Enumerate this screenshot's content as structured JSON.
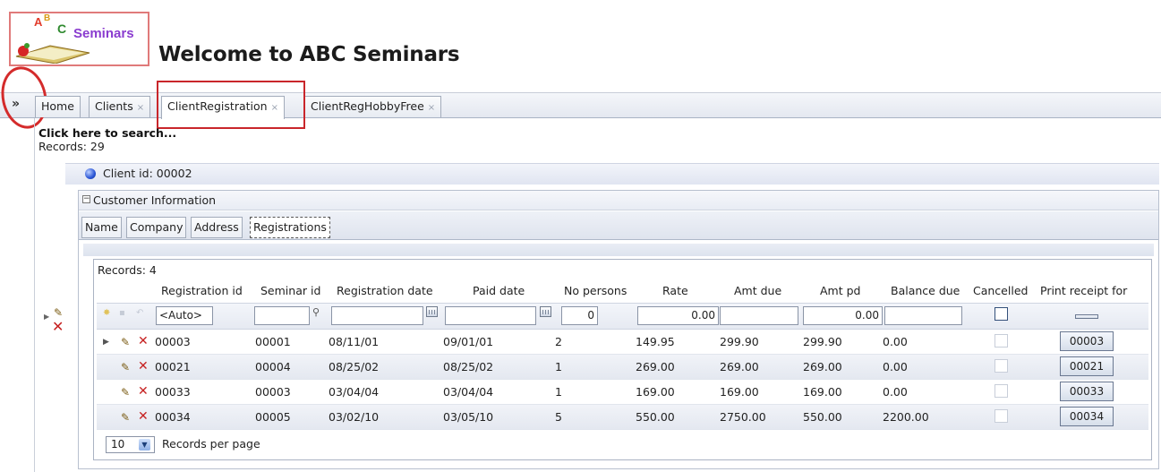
{
  "header": {
    "logo_text": "ABC Seminars",
    "welcome": "Welcome to ABC Seminars"
  },
  "nav": {
    "expand_icon": "»",
    "tabs": [
      {
        "label": "Home",
        "closable": false
      },
      {
        "label": "Clients",
        "closable": true
      },
      {
        "label": "ClientRegistration",
        "closable": true,
        "active": true
      },
      {
        "label": "ClientRegHobbyFree",
        "closable": true
      }
    ],
    "close_glyph": "×"
  },
  "main": {
    "search_link": "Click here to search...",
    "records_label": "Records: 29",
    "client_label": "Client id: 00002",
    "section_title": "Customer Information",
    "section_toggle": "⊟",
    "subtabs": [
      "Name",
      "Company",
      "Address",
      "Registrations"
    ],
    "active_subtab": "Registrations"
  },
  "grid": {
    "records_label": "Records: 4",
    "columns": [
      "Registration id",
      "Seminar id",
      "Registration date",
      "Paid date",
      "No persons",
      "Rate",
      "Amt due",
      "Amt pd",
      "Balance due",
      "Cancelled",
      "Print receipt for"
    ],
    "new_row": {
      "registration_id": "<Auto>",
      "seminar_id": "",
      "registration_date": "",
      "paid_date": "",
      "no_persons": "0",
      "rate": "0.00",
      "amt_due": "",
      "amt_pd": "0.00",
      "balance_due": "",
      "cancelled": false
    },
    "rows": [
      {
        "registration_id": "00003",
        "seminar_id": "00001",
        "registration_date": "08/11/01",
        "paid_date": "09/01/01",
        "no_persons": "2",
        "rate": "149.95",
        "amt_due": "299.90",
        "amt_pd": "299.90",
        "balance_due": "0.00",
        "cancelled": false,
        "print": "00003"
      },
      {
        "registration_id": "00021",
        "seminar_id": "00004",
        "registration_date": "08/25/02",
        "paid_date": "08/25/02",
        "no_persons": "1",
        "rate": "269.00",
        "amt_due": "269.00",
        "amt_pd": "269.00",
        "balance_due": "0.00",
        "cancelled": false,
        "print": "00021"
      },
      {
        "registration_id": "00033",
        "seminar_id": "00003",
        "registration_date": "03/04/04",
        "paid_date": "03/04/04",
        "no_persons": "1",
        "rate": "169.00",
        "amt_due": "169.00",
        "amt_pd": "169.00",
        "balance_due": "0.00",
        "cancelled": false,
        "print": "00033"
      },
      {
        "registration_id": "00034",
        "seminar_id": "00005",
        "registration_date": "03/02/10",
        "paid_date": "03/05/10",
        "no_persons": "5",
        "rate": "550.00",
        "amt_due": "2750.00",
        "amt_pd": "550.00",
        "balance_due": "2200.00",
        "cancelled": false,
        "print": "00034"
      }
    ],
    "pager": {
      "page_size": "10",
      "label": "Records per page"
    }
  },
  "icons": {
    "pencil": "✎",
    "delete": "✕",
    "expand_row": "▶",
    "search": "🔍",
    "dropdown": "▾"
  },
  "colors": {
    "annotation_red": "#d42b2b",
    "delete_red": "#c62121",
    "status_blue": "#2a55d6"
  }
}
